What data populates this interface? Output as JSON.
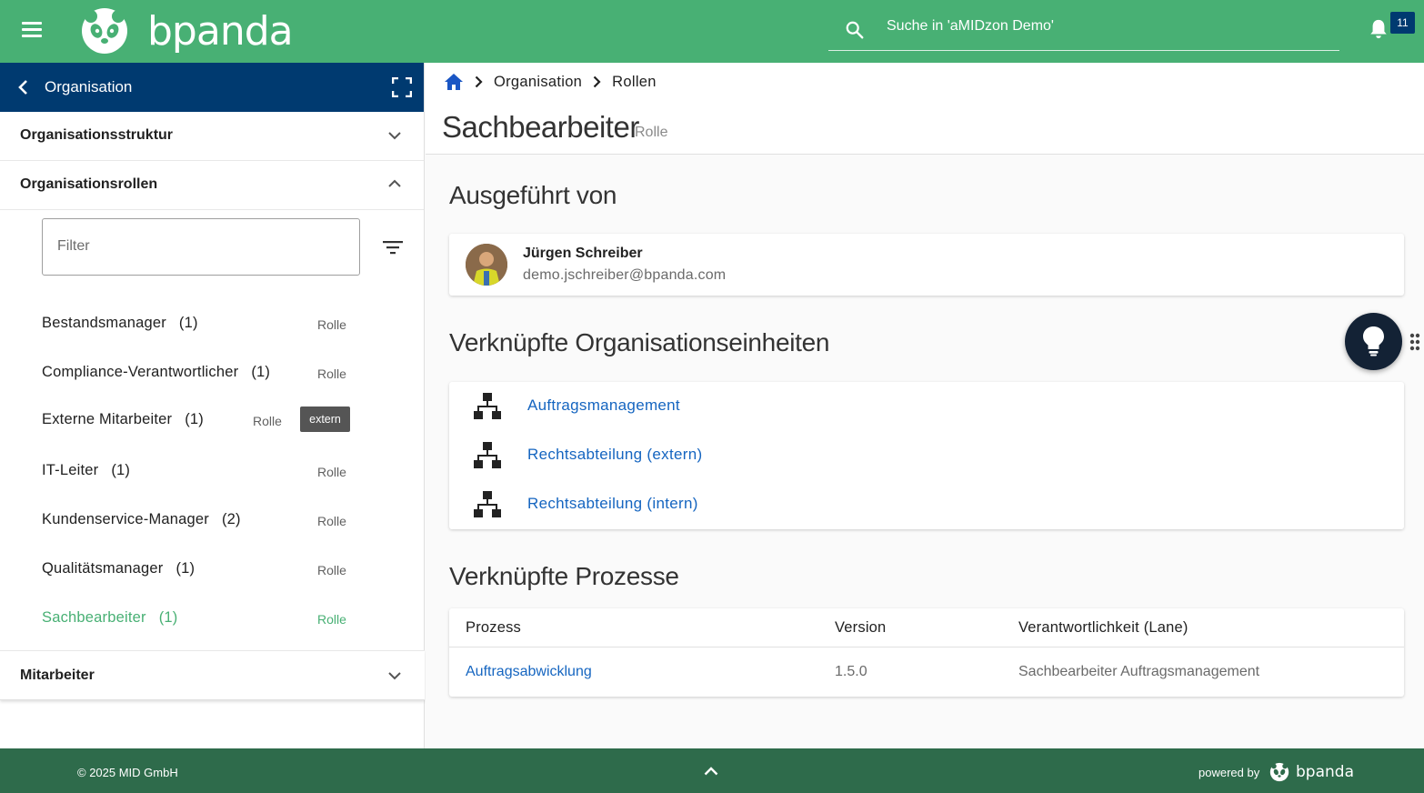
{
  "header": {
    "brand": "bpanda",
    "search_placeholder": "Suche in 'aMIDzon Demo'",
    "notification_count": "11"
  },
  "sidebar": {
    "title": "Organisation",
    "sections": {
      "structure": "Organisationsstruktur",
      "roles": "Organisationsrollen",
      "employees": "Mitarbeiter"
    },
    "filter_placeholder": "Filter",
    "roles": [
      {
        "name": "Bestandsmanager",
        "count": "(1)",
        "type": "Rolle"
      },
      {
        "name": "Compliance-Verantwortlicher",
        "count": "(1)",
        "type": "Rolle"
      },
      {
        "name": "Externe Mitarbeiter",
        "count": "(1)",
        "type": "Rolle",
        "tag": "extern"
      },
      {
        "name": "IT-Leiter",
        "count": "(1)",
        "type": "Rolle"
      },
      {
        "name": "Kundenservice-Manager",
        "count": "(2)",
        "type": "Rolle"
      },
      {
        "name": "Qualitätsmanager",
        "count": "(1)",
        "type": "Rolle"
      },
      {
        "name": "Sachbearbeiter",
        "count": "(1)",
        "type": "Rolle",
        "active": true
      }
    ]
  },
  "breadcrumb": [
    "Organisation",
    "Rollen"
  ],
  "page": {
    "title": "Sachbearbeiter",
    "subtitle": "Rolle"
  },
  "executed_by": {
    "title": "Ausgeführt von",
    "person": {
      "name": "Jürgen Schreiber",
      "email": "demo.jschreiber@bpanda.com"
    }
  },
  "org_units": {
    "title": "Verknüpfte Organisationseinheiten",
    "items": [
      "Auftragsmanagement",
      "Rechtsabteilung (extern)",
      "Rechtsabteilung (intern)"
    ]
  },
  "processes": {
    "title": "Verknüpfte Prozesse",
    "columns": [
      "Prozess",
      "Version",
      "Verantwortlichkeit (Lane)"
    ],
    "rows": [
      {
        "process": "Auftragsabwicklung",
        "version": "1.5.0",
        "lane": "Sachbearbeiter Auftragsmanagement"
      }
    ]
  },
  "footer": {
    "copyright": "© 2025 MID GmbH",
    "powered_by": "powered by",
    "brand": "bpanda"
  },
  "colors": {
    "brand_green": "#48b074",
    "sidebar_header": "#003a70",
    "footer": "#2e6b4b",
    "link": "#1565c0"
  }
}
